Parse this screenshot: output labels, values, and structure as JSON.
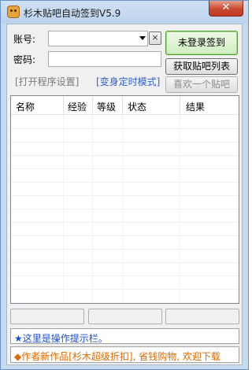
{
  "window": {
    "title": "杉木贴吧自动签到V5.9",
    "close_label": "✕"
  },
  "login": {
    "account_label": "账号:",
    "password_label": "密码:",
    "account_value": "",
    "password_value": "",
    "clear_label": "×"
  },
  "buttons": {
    "sign_in": "未登录签到",
    "fetch_list": "获取贴吧列表",
    "like_bar": "喜欢一个贴吧"
  },
  "links": {
    "open_settings": "[打开程序设置]",
    "timed_mode": "[变身定时模式]"
  },
  "table": {
    "columns": [
      "名称",
      "经验",
      "等级",
      "状态",
      "结果"
    ],
    "rows": []
  },
  "status": {
    "hint": "★这里是操作提示栏。",
    "promo": "◆作者新作品[杉木超级折扣], 省钱购物, 欢迎下载"
  },
  "colors": {
    "hint_text": "#1a4fd0",
    "promo_text": "#e06a00",
    "mode_link": "#2a5fd0",
    "sign_button_border": "#4f9d2c"
  },
  "icons": {
    "app": "tree-stump-face-icon",
    "dropdown": "chevron-down-icon",
    "clear": "close-icon"
  }
}
